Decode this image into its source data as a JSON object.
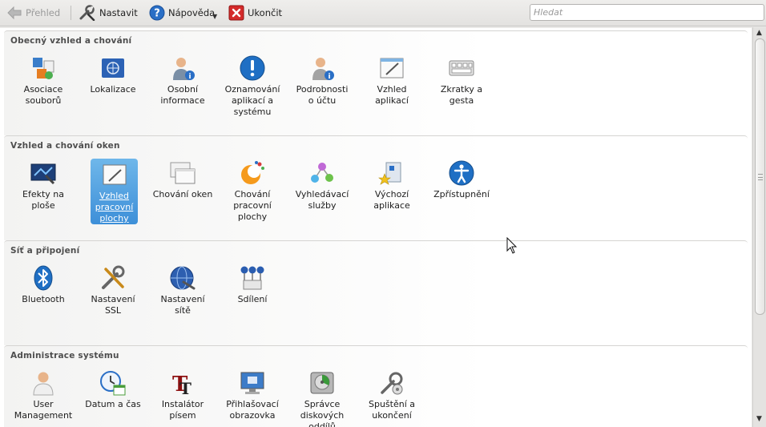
{
  "toolbar": {
    "overview_label": "Přehled",
    "configure_label": "Nastavit",
    "help_label": "Nápověda",
    "quit_label": "Ukončit"
  },
  "search": {
    "placeholder": "Hledat"
  },
  "sections": [
    {
      "title": "Obecný vzhled a chování",
      "items": [
        {
          "label": "Asociace\nsouborů",
          "icon": "file-associations-icon"
        },
        {
          "label": "Lokalizace",
          "icon": "locale-flag-icon"
        },
        {
          "label": "Osobní\ninformace",
          "icon": "user-info-icon"
        },
        {
          "label": "Oznamování\naplikací a\nsystému",
          "icon": "notification-icon"
        },
        {
          "label": "Podrobnosti\no účtu",
          "icon": "account-details-icon"
        },
        {
          "label": "Vzhled\naplikací",
          "icon": "application-appearance-icon"
        },
        {
          "label": "Zkratky a\ngesta",
          "icon": "keyboard-shortcuts-icon"
        }
      ]
    },
    {
      "title": "Vzhled a chování oken",
      "items": [
        {
          "label": "Efekty na\nploše",
          "icon": "desktop-effects-icon"
        },
        {
          "label": "Vzhled\npracovní\nplochy",
          "icon": "workspace-appearance-icon",
          "selected": true
        },
        {
          "label": "Chování oken",
          "icon": "window-behavior-icon"
        },
        {
          "label": "Chování\npracovní\nplochy",
          "icon": "workspace-behavior-icon"
        },
        {
          "label": "Vyhledávací\nslužby",
          "icon": "search-services-icon"
        },
        {
          "label": "Výchozí\naplikace",
          "icon": "default-applications-icon"
        },
        {
          "label": "Zpřístupnění",
          "icon": "accessibility-icon"
        }
      ]
    },
    {
      "title": "Síť a připojení",
      "items": [
        {
          "label": "Bluetooth",
          "icon": "bluetooth-icon"
        },
        {
          "label": "Nastavení\nSSL",
          "icon": "ssl-settings-icon"
        },
        {
          "label": "Nastavení\nsítě",
          "icon": "network-settings-icon"
        },
        {
          "label": "Sdílení",
          "icon": "sharing-icon"
        }
      ]
    },
    {
      "title": "Administrace systému",
      "items": [
        {
          "label": "User\nManagement",
          "icon": "user-management-icon"
        },
        {
          "label": "Datum a čas",
          "icon": "date-time-icon"
        },
        {
          "label": "Instalátor\npísem",
          "icon": "font-installer-icon"
        },
        {
          "label": "Přihlašovací\nobrazovka",
          "icon": "login-screen-icon"
        },
        {
          "label": "Správce\ndiskových\noddílů",
          "icon": "partition-manager-icon"
        },
        {
          "label": "Spuštění a\nukončení",
          "icon": "startup-shutdown-icon"
        }
      ]
    }
  ],
  "colors": {
    "selection": "#3d8fd8",
    "accent_blue": "#1f6fc4"
  }
}
